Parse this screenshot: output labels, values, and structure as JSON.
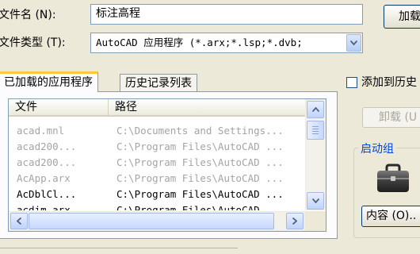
{
  "file_name_label": "文件名 (N):",
  "file_name_value": "标注高程",
  "file_type_label": "文件类型 (T):",
  "file_type_value": "AutoCAD 应用程序 (*.arx;*.lsp;*.dvb;",
  "load_button": "加载",
  "tabs": [
    {
      "label": "已加载的应用程序"
    },
    {
      "label": "历史记录列表"
    }
  ],
  "list": {
    "columns": [
      "文件",
      "路径"
    ],
    "rows": [
      {
        "file": "acad.mnl",
        "path": "C:\\Documents and Settings..."
      },
      {
        "file": "acad200...",
        "path": "C:\\Program Files\\AutoCAD ..."
      },
      {
        "file": "acad200...",
        "path": "C:\\Program Files\\AutoCAD ..."
      },
      {
        "file": "AcApp.arx",
        "path": "C:\\Program Files\\AutoCAD ..."
      },
      {
        "file": "AcDblCl...",
        "path": "C:\\Program Files\\AutoCAD ..."
      },
      {
        "file": "acdim.arx",
        "path": "C:\\Program Files\\AutoCAD ..."
      }
    ]
  },
  "add_to_history_label": "添加到历史",
  "unload_button": "卸载 (U",
  "startup_group_label": "启动组",
  "contents_button": "内容 (O)..",
  "icons": {
    "dropdown": "chevron-down-icon",
    "scroll_up": "arrow-up-icon",
    "scroll_down": "arrow-down-icon",
    "scroll_left": "arrow-left-icon",
    "scroll_right": "arrow-right-icon",
    "startup": "briefcase-icon"
  },
  "colors": {
    "dialog_bg": "#ece9d8",
    "tab_highlight": "#ffc83c",
    "group_label": "#0046d5",
    "disabled_text": "#a4a4a4"
  }
}
